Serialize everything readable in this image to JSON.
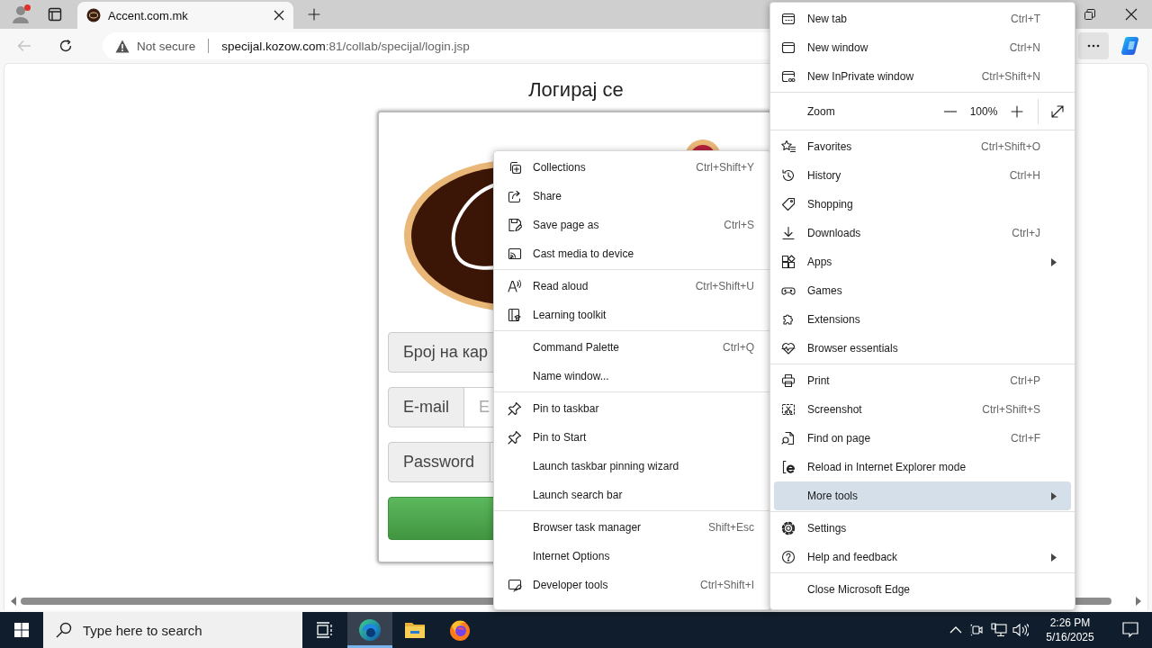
{
  "tab_strip": {
    "profile": {
      "notification": true
    },
    "tabs": [
      {
        "title": "Accent.com.mk",
        "selected": true
      }
    ]
  },
  "address_bar": {
    "security": "Not secure",
    "url_host": "specijal.kozow.com",
    "url_path": ":81/collab/specijal/login.jsp",
    "menu_button": {
      "selected": true
    }
  },
  "page": {
    "heading": "Логирај се",
    "fields": [
      {
        "label": "Број на кар"
      },
      {
        "label": "E-mail",
        "placeholder": "E"
      },
      {
        "label": "Password"
      }
    ]
  },
  "more_tools_menu": {
    "sections": [
      [
        {
          "kind": "item",
          "label": "Collections",
          "shortcut": "Ctrl+Shift+Y",
          "selected": false
        },
        {
          "kind": "item",
          "label": "Share",
          "selected": false
        },
        {
          "kind": "item",
          "label": "Save page as",
          "shortcut": "Ctrl+S",
          "selected": false
        },
        {
          "kind": "item",
          "label": "Cast media to device",
          "selected": false
        }
      ],
      [
        {
          "kind": "item",
          "label": "Read aloud",
          "shortcut": "Ctrl+Shift+U",
          "selected": false
        },
        {
          "kind": "item",
          "label": "Learning toolkit",
          "selected": false
        }
      ],
      [
        {
          "kind": "item",
          "label": "Command Palette",
          "shortcut": "Ctrl+Q",
          "selected": false
        },
        {
          "kind": "item",
          "label": "Name window...",
          "selected": false
        }
      ],
      [
        {
          "kind": "item",
          "label": "Pin to taskbar",
          "selected": false
        },
        {
          "kind": "item",
          "label": "Pin to Start",
          "selected": false
        },
        {
          "kind": "item",
          "label": "Launch taskbar pinning wizard",
          "selected": false
        },
        {
          "kind": "item",
          "label": "Launch search bar",
          "selected": false
        }
      ],
      [
        {
          "kind": "item",
          "label": "Browser task manager",
          "shortcut": "Shift+Esc",
          "selected": false
        },
        {
          "kind": "item",
          "label": "Internet Options",
          "selected": false
        },
        {
          "kind": "item",
          "label": "Developer tools",
          "shortcut": "Ctrl+Shift+I",
          "selected": false
        }
      ]
    ]
  },
  "main_menu": {
    "sections": [
      [
        {
          "kind": "item",
          "label": "New tab",
          "shortcut": "Ctrl+T",
          "submenu": false,
          "selected": false
        },
        {
          "kind": "item",
          "label": "New window",
          "shortcut": "Ctrl+N",
          "submenu": false,
          "selected": false
        },
        {
          "kind": "item",
          "label": "New InPrivate window",
          "shortcut": "Ctrl+Shift+N",
          "submenu": false,
          "selected": false
        }
      ],
      [
        {
          "kind": "zoom",
          "label": "Zoom",
          "value": "100%"
        }
      ],
      [
        {
          "kind": "item",
          "label": "Favorites",
          "shortcut": "Ctrl+Shift+O",
          "submenu": false,
          "selected": false
        },
        {
          "kind": "item",
          "label": "History",
          "shortcut": "Ctrl+H",
          "submenu": false,
          "selected": false
        },
        {
          "kind": "item",
          "label": "Shopping",
          "submenu": false,
          "selected": false
        },
        {
          "kind": "item",
          "label": "Downloads",
          "shortcut": "Ctrl+J",
          "submenu": false,
          "selected": false
        },
        {
          "kind": "item",
          "label": "Apps",
          "submenu": true,
          "selected": false
        },
        {
          "kind": "item",
          "label": "Games",
          "submenu": false,
          "selected": false
        },
        {
          "kind": "item",
          "label": "Extensions",
          "submenu": false,
          "selected": false
        },
        {
          "kind": "item",
          "label": "Browser essentials",
          "submenu": false,
          "selected": false
        }
      ],
      [
        {
          "kind": "item",
          "label": "Print",
          "shortcut": "Ctrl+P",
          "submenu": false,
          "selected": false
        },
        {
          "kind": "item",
          "label": "Screenshot",
          "shortcut": "Ctrl+Shift+S",
          "submenu": false,
          "selected": false
        },
        {
          "kind": "item",
          "label": "Find on page",
          "shortcut": "Ctrl+F",
          "submenu": false,
          "selected": false
        },
        {
          "kind": "item",
          "label": "Reload in Internet Explorer mode",
          "submenu": false,
          "selected": false
        },
        {
          "kind": "item",
          "label": "More tools",
          "submenu": true,
          "selected": true
        }
      ],
      [
        {
          "kind": "item",
          "label": "Settings",
          "submenu": false,
          "selected": false
        },
        {
          "kind": "item",
          "label": "Help and feedback",
          "submenu": true,
          "selected": false
        }
      ],
      [
        {
          "kind": "item",
          "label": "Close Microsoft Edge",
          "submenu": false,
          "selected": false
        }
      ]
    ]
  },
  "taskbar": {
    "search_placeholder": "Type here to search",
    "apps": [
      {
        "selected": false
      },
      {
        "selected": true
      },
      {
        "selected": false
      },
      {
        "selected": false
      }
    ],
    "time": "2:26 PM",
    "date": "5/16/2025"
  }
}
